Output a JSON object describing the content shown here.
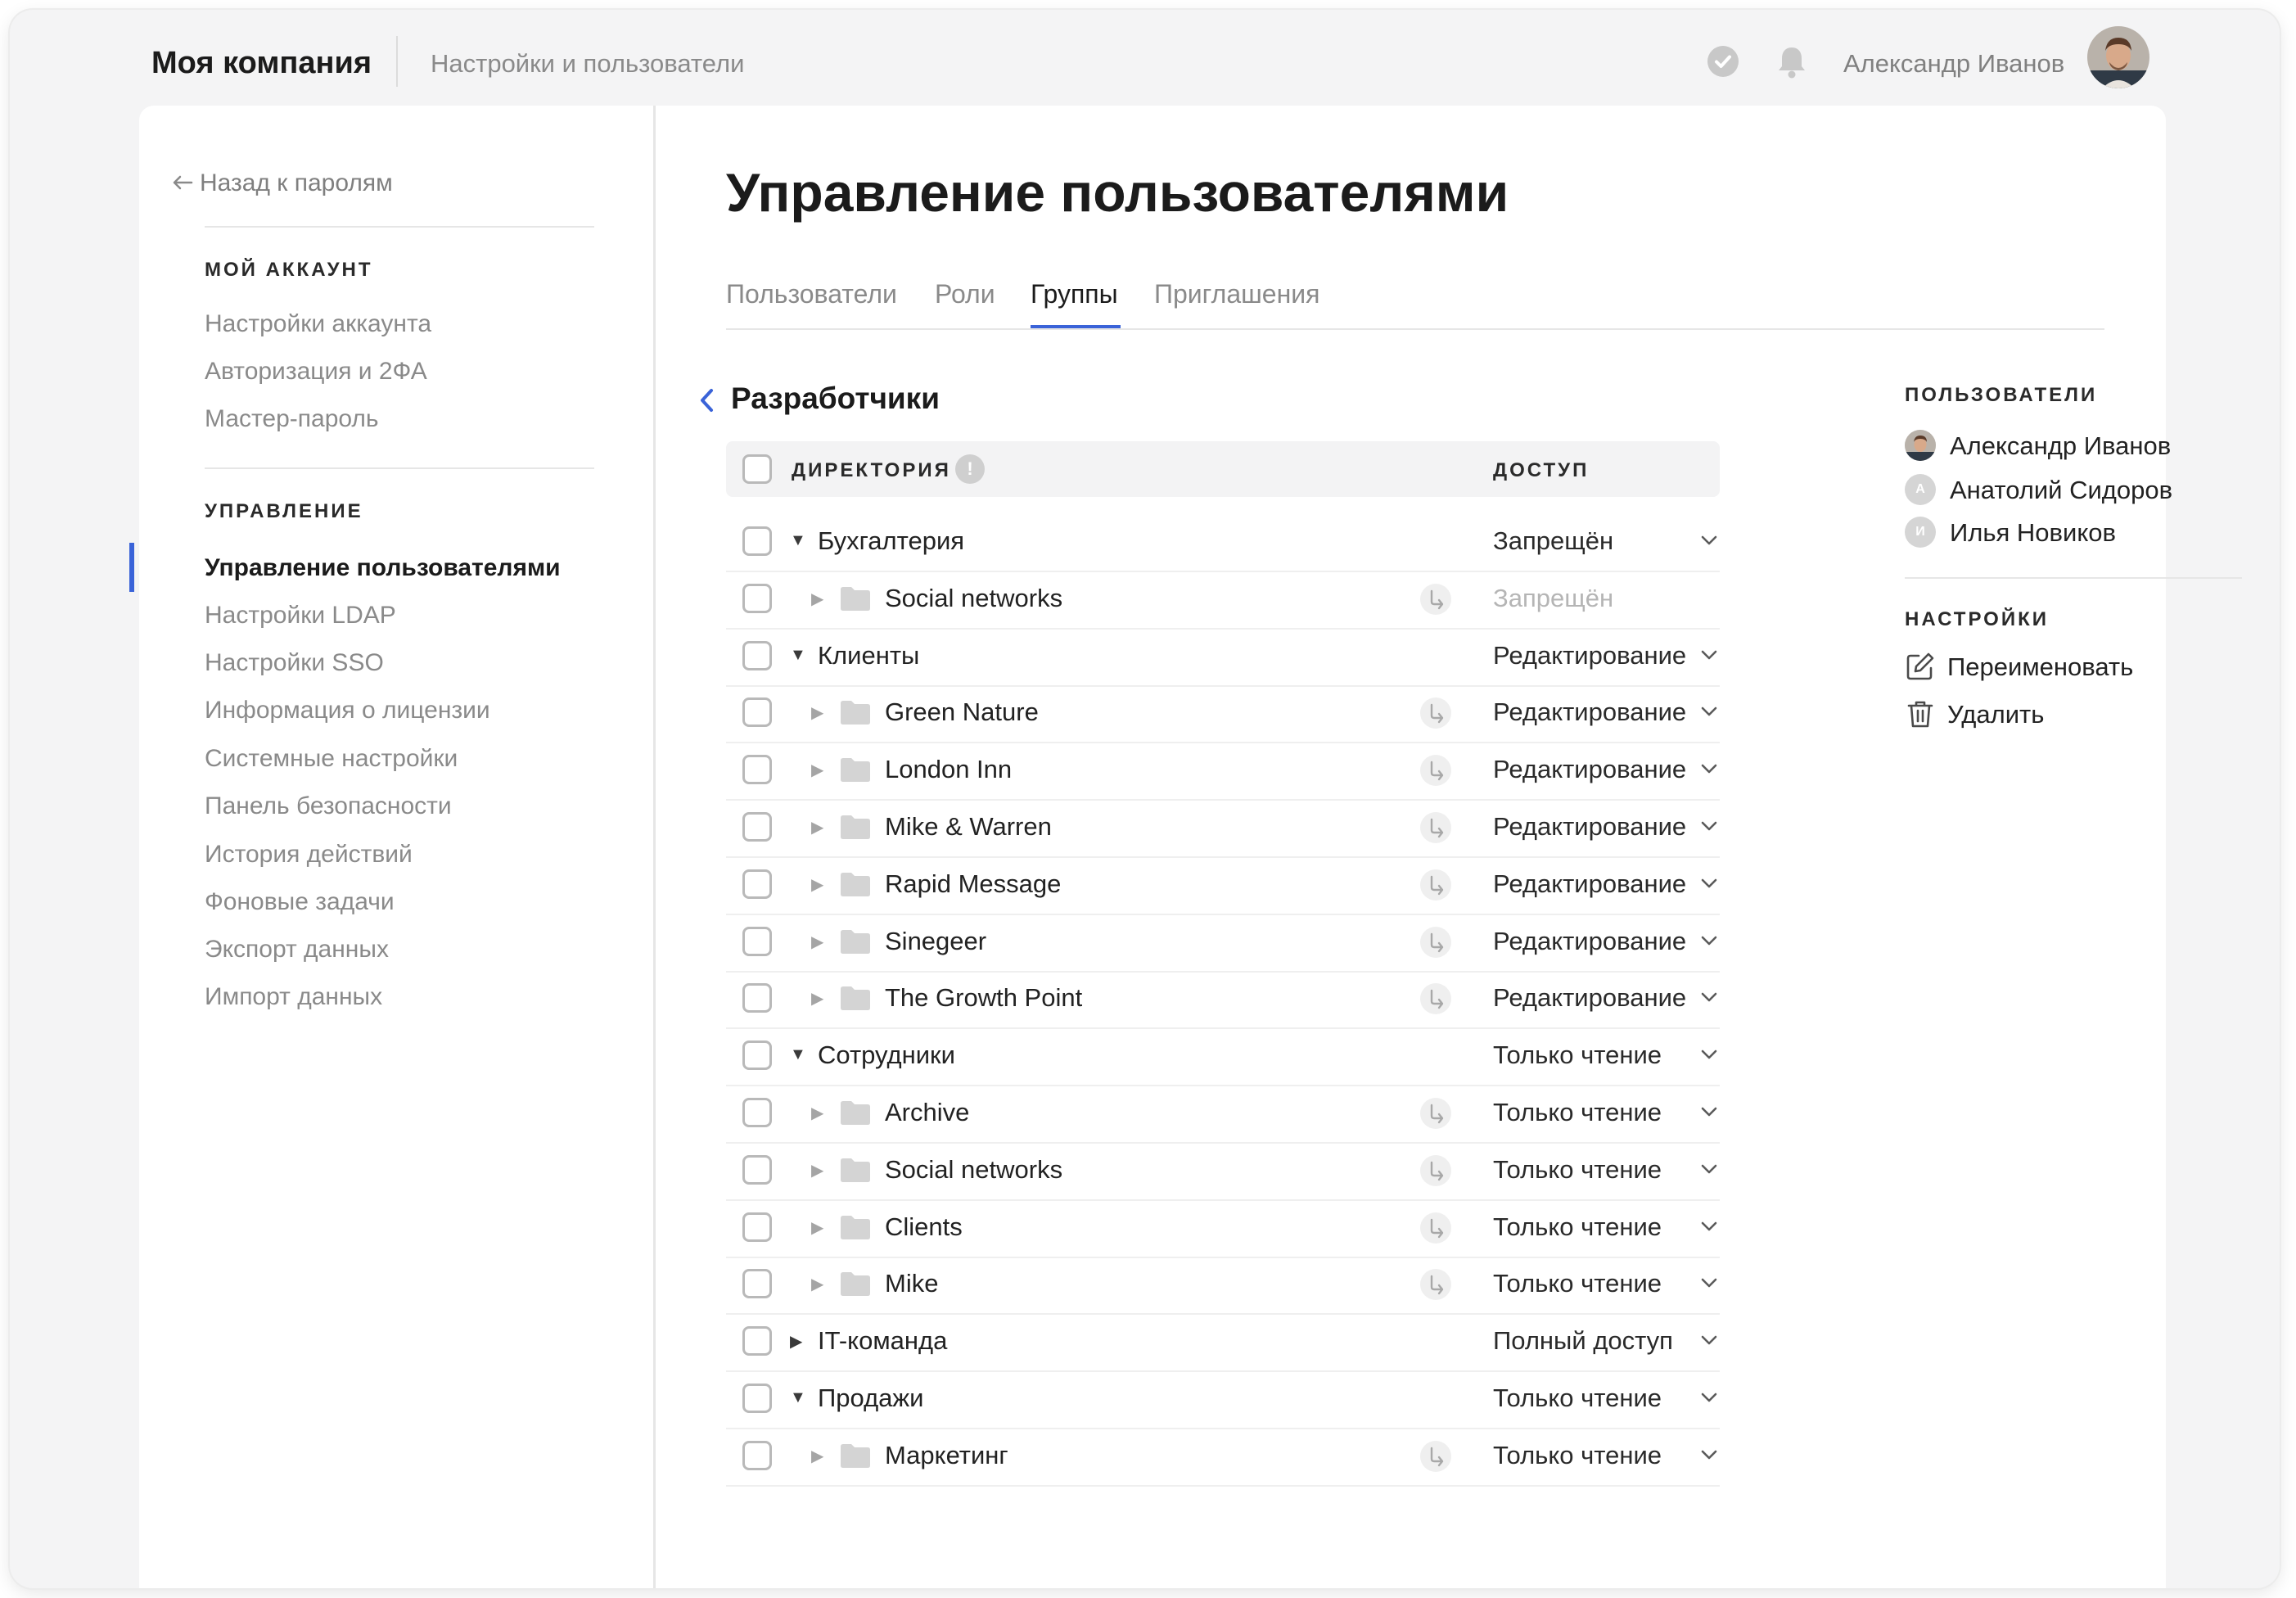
{
  "header": {
    "brand": "Моя компания",
    "section": "Настройки и пользователи",
    "user_name": "Александр Иванов"
  },
  "sidebar": {
    "back_label": "Назад к паролям",
    "account_heading": "МОЙ АККАУНТ",
    "account_items": [
      "Настройки аккаунта",
      "Авторизация и 2ФА",
      "Мастер-пароль"
    ],
    "manage_heading": "УПРАВЛЕНИЕ",
    "manage_items": [
      "Управление пользователями",
      "Настройки LDAP",
      "Настройки SSO",
      "Информация о лицензии",
      "Системные настройки",
      "Панель безопасности",
      "История действий",
      "Фоновые задачи",
      "Экспорт данных",
      "Импорт данных"
    ],
    "active_item": "Управление пользователями"
  },
  "main": {
    "title": "Управление пользователями",
    "tabs": [
      "Пользователи",
      "Роли",
      "Группы",
      "Приглашения"
    ],
    "active_tab": "Группы",
    "group_name": "Разработчики",
    "table": {
      "col_directory": "ДИРЕКТОРИЯ",
      "col_access": "ДОСТУП",
      "info_glyph": "!",
      "rows": [
        {
          "label": "Бухгалтерия",
          "level": 0,
          "expanded": true,
          "access": "Запрещён",
          "inherited": false
        },
        {
          "label": "Social networks",
          "level": 1,
          "access": "Запрещён",
          "inherited": true,
          "muted": true
        },
        {
          "label": "Клиенты",
          "level": 0,
          "expanded": true,
          "access": "Редактирование",
          "inherited": false
        },
        {
          "label": "Green Nature",
          "level": 1,
          "access": "Редактирование",
          "inherited": true
        },
        {
          "label": "London Inn",
          "level": 1,
          "access": "Редактирование",
          "inherited": true
        },
        {
          "label": "Mike & Warren",
          "level": 1,
          "access": "Редактирование",
          "inherited": true
        },
        {
          "label": "Rapid Message",
          "level": 1,
          "access": "Редактирование",
          "inherited": true
        },
        {
          "label": "Sinegeer",
          "level": 1,
          "access": "Редактирование",
          "inherited": true
        },
        {
          "label": "The Growth Point",
          "level": 1,
          "access": "Редактирование",
          "inherited": true
        },
        {
          "label": "Сотрудники",
          "level": 0,
          "expanded": true,
          "access": "Только чтение",
          "inherited": false
        },
        {
          "label": "Archive",
          "level": 1,
          "access": "Только чтение",
          "inherited": true
        },
        {
          "label": "Social networks",
          "level": 1,
          "access": "Только чтение",
          "inherited": true
        },
        {
          "label": "Clients",
          "level": 1,
          "access": "Только чтение",
          "inherited": true
        },
        {
          "label": "Mike",
          "level": 1,
          "access": "Только чтение",
          "inherited": true
        },
        {
          "label": "IT-команда",
          "level": 0,
          "expanded": false,
          "access": "Полный доступ",
          "inherited": false
        },
        {
          "label": "Продажи",
          "level": 0,
          "expanded": true,
          "access": "Только чтение",
          "inherited": false
        },
        {
          "label": "Маркетинг",
          "level": 1,
          "access": "Только чтение",
          "inherited": true
        }
      ]
    }
  },
  "right_panel": {
    "users_heading": "ПОЛЬЗОВАТЕЛИ",
    "users": [
      {
        "name": "Александр Иванов",
        "initial": "",
        "photo": true
      },
      {
        "name": "Анатолий Сидоров",
        "initial": "А",
        "photo": false
      },
      {
        "name": "Илья Новиков",
        "initial": "И",
        "photo": false
      }
    ],
    "settings_heading": "НАСТРОЙКИ",
    "rename_label": "Переименовать",
    "delete_label": "Удалить"
  },
  "colors": {
    "accent": "#3a63d8",
    "muted_text": "#8a8a8a"
  },
  "icons": {
    "header": [
      "check-circle-icon",
      "bell-icon",
      "avatar"
    ],
    "row": [
      "checkbox",
      "caret-icon",
      "folder-icon",
      "inherit-arrow-icon",
      "chevron-down-icon"
    ],
    "panel": [
      "edit-icon",
      "trash-icon"
    ]
  }
}
